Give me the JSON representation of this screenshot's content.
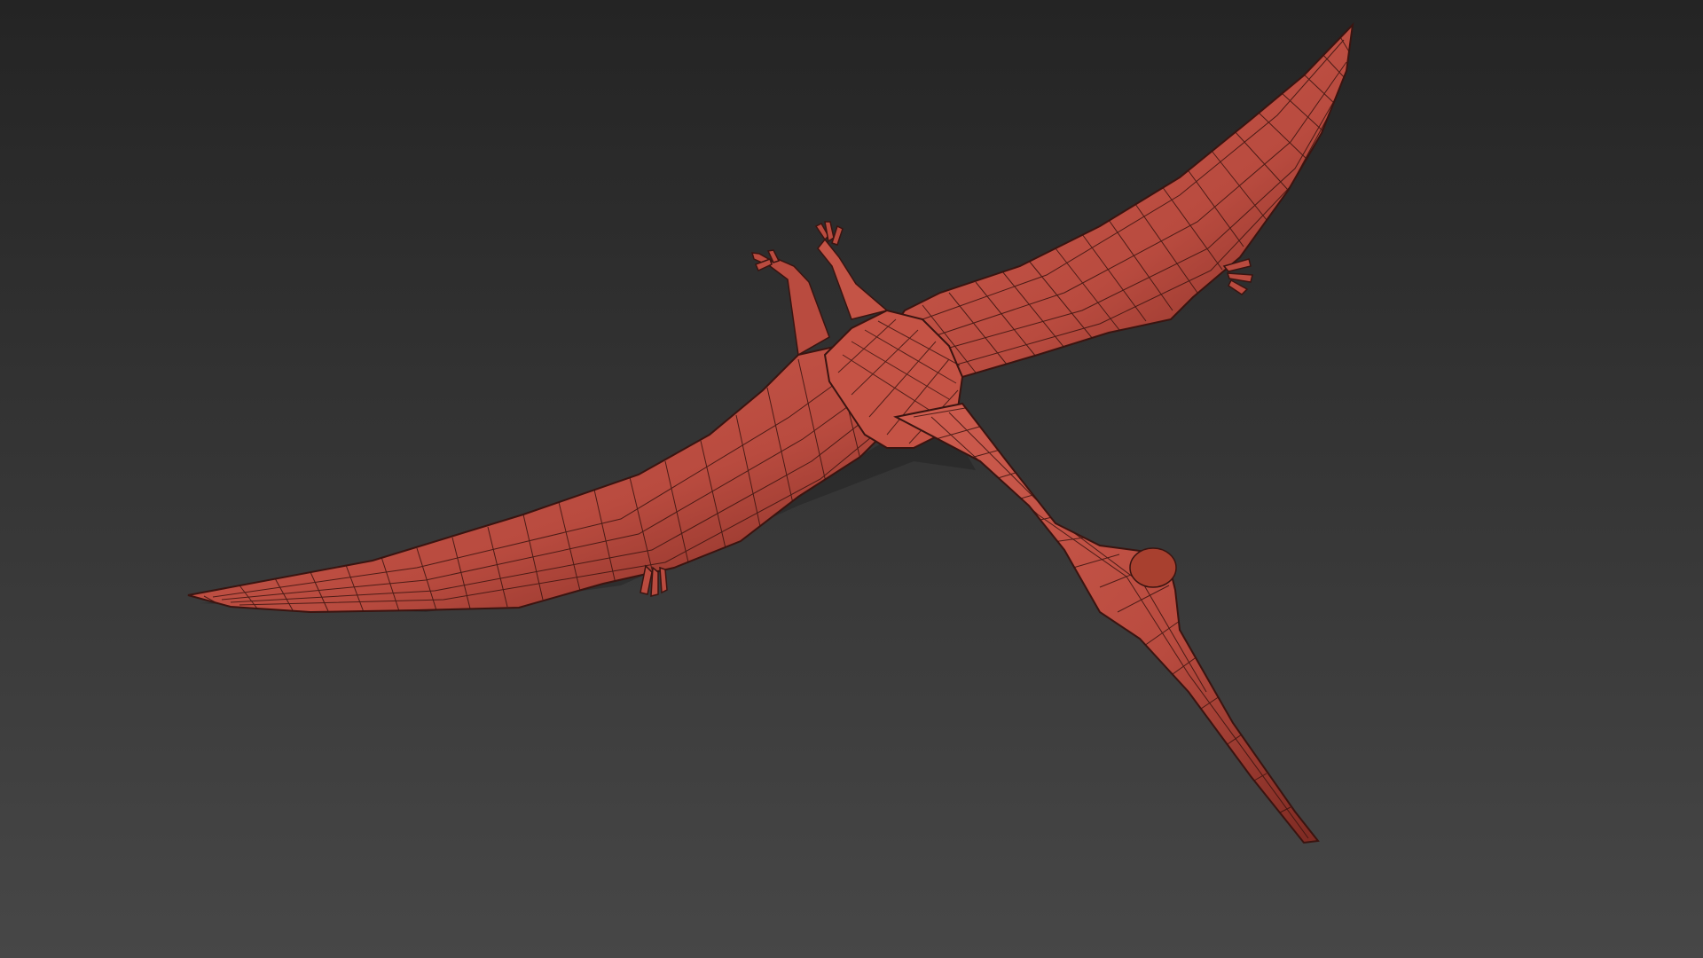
{
  "scene": {
    "subject": "pterosaur-wireframe-model",
    "render_mode": "shaded-with-wireframe",
    "colors": {
      "background_top": "#242424",
      "background_bottom": "#474747",
      "mesh_fill": "#b94b3f",
      "mesh_fill_light": "#cf5d4f",
      "mesh_shadow": "#7d2a22",
      "wire": "#3a1410"
    }
  }
}
